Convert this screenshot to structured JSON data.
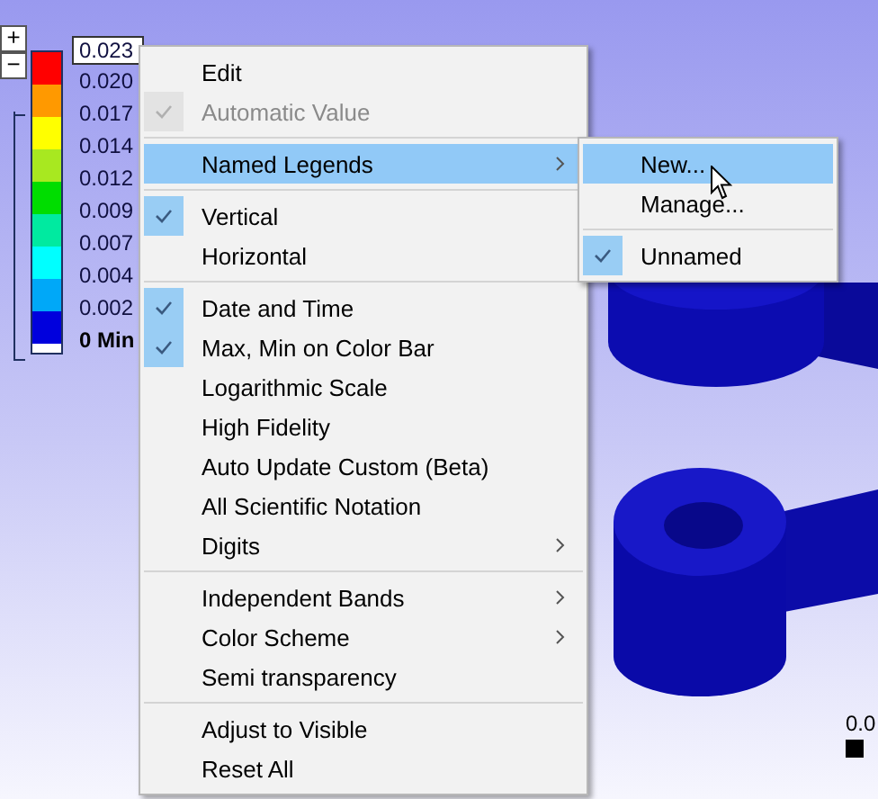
{
  "legend": {
    "expand_label": "+",
    "collapse_label": "−",
    "max_label": "0.023",
    "bands": [
      {
        "color": "#ff0000"
      },
      {
        "color": "#ff9900"
      },
      {
        "color": "#ffff00"
      },
      {
        "color": "#a8e820"
      },
      {
        "color": "#00dd00"
      },
      {
        "color": "#00eaa0"
      },
      {
        "color": "#00ffff"
      },
      {
        "color": "#00a8f8"
      },
      {
        "color": "#0000dd"
      }
    ],
    "labels": [
      "0.020",
      "0.017",
      "0.014",
      "0.012",
      "0.009",
      "0.007",
      "0.004",
      "0.002"
    ],
    "min_label": "0 Min"
  },
  "context_menu": {
    "items": [
      {
        "kind": "item",
        "label": "Edit",
        "checked": false,
        "disabled": false,
        "selected": false,
        "has_submenu": false
      },
      {
        "kind": "item",
        "label": "Automatic Value",
        "checked": true,
        "disabled": true,
        "selected": false,
        "has_submenu": false
      },
      {
        "kind": "separator"
      },
      {
        "kind": "item",
        "label": "Named Legends",
        "checked": false,
        "disabled": false,
        "selected": true,
        "has_submenu": true
      },
      {
        "kind": "separator"
      },
      {
        "kind": "item",
        "label": "Vertical",
        "checked": true,
        "disabled": false,
        "selected": false,
        "has_submenu": false
      },
      {
        "kind": "item",
        "label": "Horizontal",
        "checked": false,
        "disabled": false,
        "selected": false,
        "has_submenu": false
      },
      {
        "kind": "separator"
      },
      {
        "kind": "item",
        "label": "Date and Time",
        "checked": true,
        "disabled": false,
        "selected": false,
        "has_submenu": false
      },
      {
        "kind": "item",
        "label": "Max, Min on Color Bar",
        "checked": true,
        "disabled": false,
        "selected": false,
        "has_submenu": false
      },
      {
        "kind": "item",
        "label": "Logarithmic Scale",
        "checked": false,
        "disabled": false,
        "selected": false,
        "has_submenu": false
      },
      {
        "kind": "item",
        "label": "High Fidelity",
        "checked": false,
        "disabled": false,
        "selected": false,
        "has_submenu": false
      },
      {
        "kind": "item",
        "label": "Auto Update Custom (Beta)",
        "checked": false,
        "disabled": false,
        "selected": false,
        "has_submenu": false
      },
      {
        "kind": "item",
        "label": "All Scientific Notation",
        "checked": false,
        "disabled": false,
        "selected": false,
        "has_submenu": false
      },
      {
        "kind": "item",
        "label": "Digits",
        "checked": false,
        "disabled": false,
        "selected": false,
        "has_submenu": true
      },
      {
        "kind": "separator"
      },
      {
        "kind": "item",
        "label": "Independent Bands",
        "checked": false,
        "disabled": false,
        "selected": false,
        "has_submenu": true
      },
      {
        "kind": "item",
        "label": "Color Scheme",
        "checked": false,
        "disabled": false,
        "selected": false,
        "has_submenu": true
      },
      {
        "kind": "item",
        "label": "Semi transparency",
        "checked": false,
        "disabled": false,
        "selected": false,
        "has_submenu": false
      },
      {
        "kind": "separator"
      },
      {
        "kind": "item",
        "label": "Adjust to Visible",
        "checked": false,
        "disabled": false,
        "selected": false,
        "has_submenu": false
      },
      {
        "kind": "item",
        "label": "Reset All",
        "checked": false,
        "disabled": false,
        "selected": false,
        "has_submenu": false
      }
    ]
  },
  "submenu": {
    "items": [
      {
        "kind": "item",
        "label": "New...",
        "checked": false,
        "disabled": false,
        "selected": true,
        "has_submenu": false
      },
      {
        "kind": "item",
        "label": "Manage...",
        "checked": false,
        "disabled": false,
        "selected": false,
        "has_submenu": false
      },
      {
        "kind": "separator"
      },
      {
        "kind": "item",
        "label": "Unnamed",
        "checked": true,
        "disabled": false,
        "selected": false,
        "has_submenu": false
      }
    ]
  },
  "corner_label": "0.0"
}
